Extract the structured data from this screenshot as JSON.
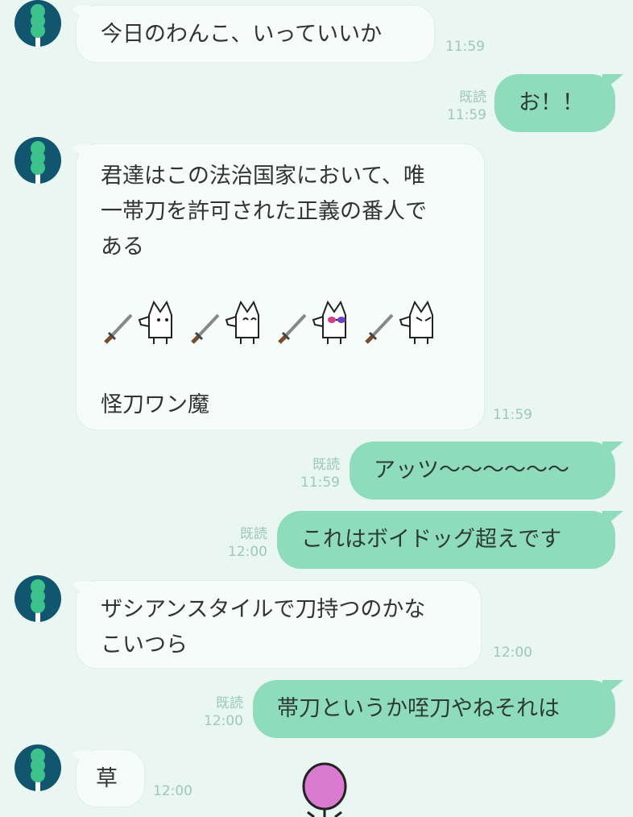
{
  "messages": [
    {
      "dir": "in",
      "text": "今日のわんこ、いっていいか",
      "time": "11:59"
    },
    {
      "dir": "out",
      "text": "お！！",
      "read": "既読",
      "time": "11:59"
    },
    {
      "dir": "in",
      "lines": [
        "君達はこの法治国家において、唯",
        "一帯刀を許可された正義の番人で",
        "ある"
      ],
      "stickers": [
        "sword-icon",
        "dog-sticker",
        "sword-icon",
        "dog-sticker-happy",
        "sword-icon",
        "dog-sticker-sunglasses",
        "sword-icon",
        "dog-sticker-serious"
      ],
      "footer": "怪刀ワン魔",
      "time": "11:59"
    },
    {
      "dir": "out",
      "text": "アッツ〜〜〜〜〜〜",
      "read": "既読",
      "time": "11:59"
    },
    {
      "dir": "out",
      "text": "これはボイドッグ超えです",
      "read": "既読",
      "time": "12:00"
    },
    {
      "dir": "in",
      "lines": [
        "ザシアンスタイルで刀持つのかな",
        "こいつら"
      ],
      "time": "12:00"
    },
    {
      "dir": "out",
      "text": "帯刀というか咥刀やねそれは",
      "read": "既読",
      "time": "12:00"
    },
    {
      "dir": "in",
      "text": "草",
      "time": "12:00"
    }
  ],
  "colors": {
    "background": "#eaf6f2",
    "incoming": "#f6fcfa",
    "outgoing": "#8fdcbd",
    "avatar": "#12556e",
    "avatar_icon": "#3cc28a",
    "meta": "#9cc9b8",
    "sticker_partial": "#d87ad0"
  }
}
